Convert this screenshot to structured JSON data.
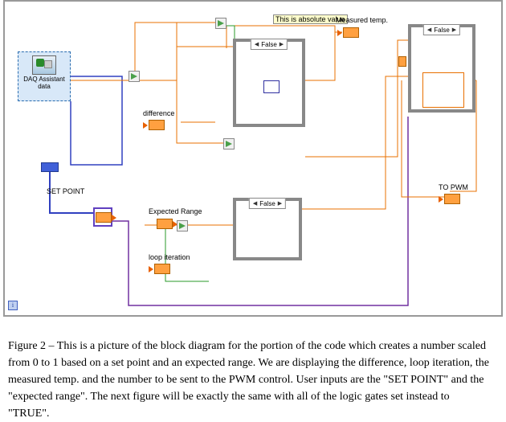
{
  "daq": {
    "line1": "DAQ Assistant",
    "line2": "data"
  },
  "labels": {
    "setpoint": "SET POINT",
    "difference": "difference",
    "expected_range": "Expected Range",
    "loop_iteration": "loop iteration",
    "measured_temp": "Measured temp.",
    "to_pwm": "TO PWM",
    "absolute_tip": "This is absolute value"
  },
  "case_selectors": {
    "case1": "False",
    "case2": "False",
    "case3": "False"
  },
  "caption": "Figure 2 – This is a picture of the block diagram for the portion of the code which creates a number scaled from 0 to 1 based on a set point and an expected range.  We are displaying the difference, loop iteration, the measured temp. and the number to be sent to the PWM control.  User inputs are the \"SET POINT\" and the \"expected range\".  The next figure will be exactly the same with all of the logic gates set instead to \"TRUE\"."
}
